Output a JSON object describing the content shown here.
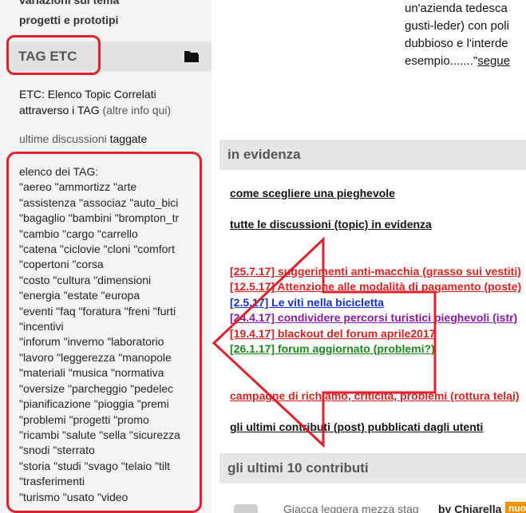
{
  "sidebar": {
    "top_lines": [
      "variazioni sul tema",
      "progetti e prototipi"
    ],
    "tag_header": {
      "title": "TAG ETC",
      "icon": "folder-icon"
    },
    "etc_line1": "ETC: Elenco Topic Correlati",
    "etc_line2": "attraverso i TAG",
    "etc_info": "(altre info qui)",
    "ultime_prefix": "ultime discussioni",
    "ultime_link": "taggate",
    "tags_title": "elenco dei TAG:",
    "tags_lines": [
      "\"aereo \"ammortizz \"arte",
      "\"assistenza \"associaz \"auto_bici",
      "\"bagaglio \"bambini \"brompton_tr",
      "\"cambio \"cargo \"carrello",
      "\"catena \"ciclovie \"cloni \"comfort",
      "\"copertoni \"corsa",
      "\"costo \"cultura \"dimensioni",
      "\"energia \"estate \"europa",
      "\"eventi \"faq \"foratura \"freni \"furti",
      "\"incentivi",
      "\"inforum \"inverno \"laboratorio",
      "\"lavoro \"leggerezza \"manopole",
      "\"materiali \"musica \"normativa",
      "\"oversize \"parcheggio \"pedelec",
      "\"pianificazione \"pioggia \"premi",
      "\"problemi \"progetti \"promo",
      "\"ricambi \"salute \"sella \"sicurezza",
      "\"snodi \"sterrato",
      "\"storia \"studi \"svago \"telaio \"tilt",
      "\"trasferimenti",
      "\"turismo \"usato \"video"
    ]
  },
  "main": {
    "article_lines": [
      "un'azienda tedesca",
      "gusti-leder) con poli",
      "dubbioso e l'interde",
      "esempio.......\""
    ],
    "article_link": "segue",
    "evidenza": {
      "title": "in evidenza",
      "link1": "come scegliere una pieghevole",
      "link2": "tutte le discussioni (topic) in evidenza",
      "news": [
        {
          "text": "[25.7.17] suggerimenti anti-macchia (grasso sui vestiti)",
          "color": "#e02020"
        },
        {
          "text": "[12.5.17] Attenzione alle modalità di pagamento (poste)",
          "color": "#e02020"
        },
        {
          "text": "[2.5.17] Le viti nella bicicletta",
          "color": "#1030d0"
        },
        {
          "text": "[24.4.17] condividere percorsi turistici pieghevoli (istr)",
          "color": "#8a1aa8"
        },
        {
          "text": "[19.4.17] blackout del forum aprile2017",
          "color": "#e02020"
        },
        {
          "text": "[26.1.17] forum aggiornato (problemi?)",
          "color": "#1a8a1a"
        }
      ],
      "campagne": "campagne di richiamo, criticità, problemi (rottura telai)",
      "ultimi_link": "gli ultimi contributi (post) pubblicati dagli utenti"
    },
    "ultimi": {
      "title": "gli ultimi 10 contributi",
      "post_title": "Giacca leggera mezza stag",
      "post_author_prefix": "by",
      "post_author": "Chiarella",
      "badge": "nuo"
    }
  },
  "colors": {
    "annotation_red": "#e0202a",
    "header_grey": "#e6e6e6",
    "sidebar_bg": "#f3f3f3"
  }
}
